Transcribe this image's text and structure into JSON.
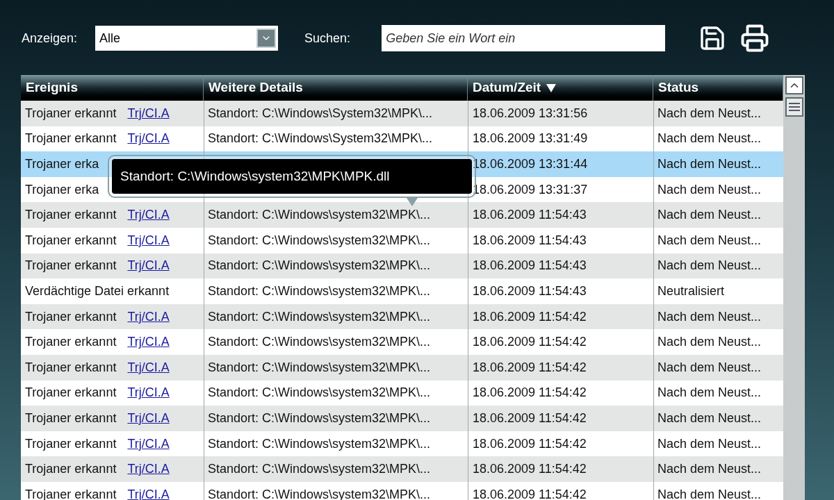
{
  "toolbar": {
    "filter_label": "Anzeigen:",
    "filter_value": "Alle",
    "search_label": "Suchen:",
    "search_placeholder": "Geben Sie ein Wort ein"
  },
  "table": {
    "columns": [
      {
        "label": "Ereignis",
        "sorted": false
      },
      {
        "label": "Weitere Details",
        "sorted": false
      },
      {
        "label": "Datum/Zeit",
        "sorted": true
      },
      {
        "label": "Status",
        "sorted": false
      }
    ],
    "rows": [
      {
        "event": "Trojaner erkannt",
        "link": "Trj/CI.A",
        "details": "Standort: C:\\Windows\\System32\\MPK\\...",
        "time": "18.06.2009 13:31:56",
        "status": "Nach dem Neust...",
        "selected": false
      },
      {
        "event": "Trojaner erkannt",
        "link": "Trj/CI.A",
        "details": "Standort: C:\\Windows\\System32\\MPK\\...",
        "time": "18.06.2009 13:31:49",
        "status": "Nach dem Neust...",
        "selected": false
      },
      {
        "event": "Trojaner erka",
        "time": "18.06.2009 13:31:44",
        "status": "Nach dem Neust...",
        "selected": true
      },
      {
        "event": "Trojaner erka",
        "time": "18.06.2009 13:31:37",
        "status": "Nach dem Neust...",
        "selected": false
      },
      {
        "event": "Trojaner erkannt",
        "link": "Trj/CI.A",
        "details": "Standort: C:\\Windows\\system32\\MPK\\...",
        "time": "18.06.2009 11:54:43",
        "status": "Nach dem Neust...",
        "selected": false
      },
      {
        "event": "Trojaner erkannt",
        "link": "Trj/CI.A",
        "details": "Standort: C:\\Windows\\system32\\MPK\\...",
        "time": "18.06.2009 11:54:43",
        "status": "Nach dem Neust...",
        "selected": false
      },
      {
        "event": "Trojaner erkannt",
        "link": "Trj/CI.A",
        "details": "Standort: C:\\Windows\\system32\\MPK\\...",
        "time": "18.06.2009 11:54:43",
        "status": "Nach dem Neust...",
        "selected": false
      },
      {
        "event": "Verdächtige Datei erkannt",
        "details": "Standort: C:\\Windows\\system32\\MPK\\...",
        "time": "18.06.2009 11:54:43",
        "status": "Neutralisiert",
        "selected": false
      },
      {
        "event": "Trojaner erkannt",
        "link": "Trj/CI.A",
        "details": "Standort: C:\\Windows\\system32\\MPK\\...",
        "time": "18.06.2009 11:54:42",
        "status": "Nach dem Neust...",
        "selected": false
      },
      {
        "event": "Trojaner erkannt",
        "link": "Trj/CI.A",
        "details": "Standort: C:\\Windows\\system32\\MPK\\...",
        "time": "18.06.2009 11:54:42",
        "status": "Nach dem Neust...",
        "selected": false
      },
      {
        "event": "Trojaner erkannt",
        "link": "Trj/CI.A",
        "details": "Standort: C:\\Windows\\system32\\MPK\\...",
        "time": "18.06.2009 11:54:42",
        "status": "Nach dem Neust...",
        "selected": false
      },
      {
        "event": "Trojaner erkannt",
        "link": "Trj/CI.A",
        "details": "Standort: C:\\Windows\\system32\\MPK\\...",
        "time": "18.06.2009 11:54:42",
        "status": "Nach dem Neust...",
        "selected": false
      },
      {
        "event": "Trojaner erkannt",
        "link": "Trj/CI.A",
        "details": "Standort: C:\\Windows\\system32\\MPK\\...",
        "time": "18.06.2009 11:54:42",
        "status": "Nach dem Neust...",
        "selected": false
      },
      {
        "event": "Trojaner erkannt",
        "link": "Trj/CI.A",
        "details": "Standort: C:\\Windows\\system32\\MPK\\...",
        "time": "18.06.2009 11:54:42",
        "status": "Nach dem Neust...",
        "selected": false
      },
      {
        "event": "Trojaner erkannt",
        "link": "Trj/CI.A",
        "details": "Standort: C:\\Windows\\system32\\MPK\\...",
        "time": "18.06.2009 11:54:42",
        "status": "Nach dem Neust...",
        "selected": false
      },
      {
        "event": "Trojaner erkannt",
        "link": "Trj/CI.A",
        "details": "Standort: C:\\Windows\\system32\\MPK\\...",
        "time": "18.06.2009 11:54:42",
        "status": "Nach dem Neust...",
        "selected": false
      }
    ]
  },
  "tooltip": {
    "text": "Standort: C:\\Windows\\system32\\MPK\\MPK.dll"
  }
}
